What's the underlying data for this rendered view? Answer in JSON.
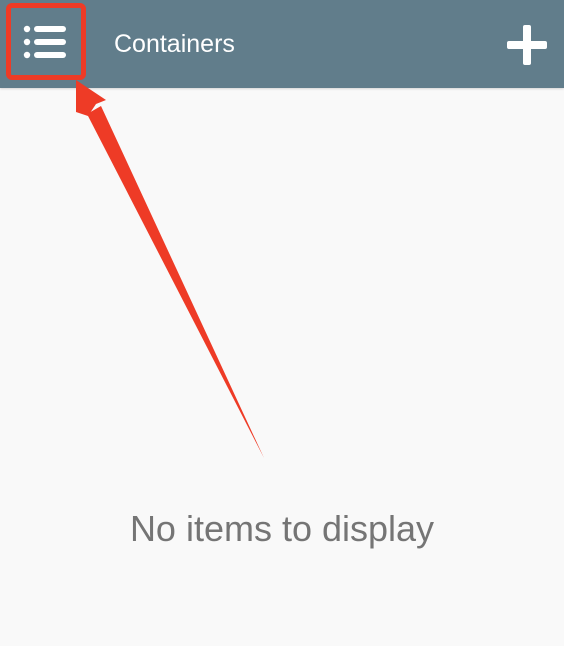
{
  "app_bar": {
    "title": "Containers",
    "background_color": "#617d8b",
    "menu_icon": "list-menu-icon",
    "add_icon": "plus-icon"
  },
  "main": {
    "empty_state_text": "No items to display"
  },
  "annotation": {
    "highlight_color": "#ee3b26",
    "arrow_icon": "arrow-pointing-to-menu"
  }
}
